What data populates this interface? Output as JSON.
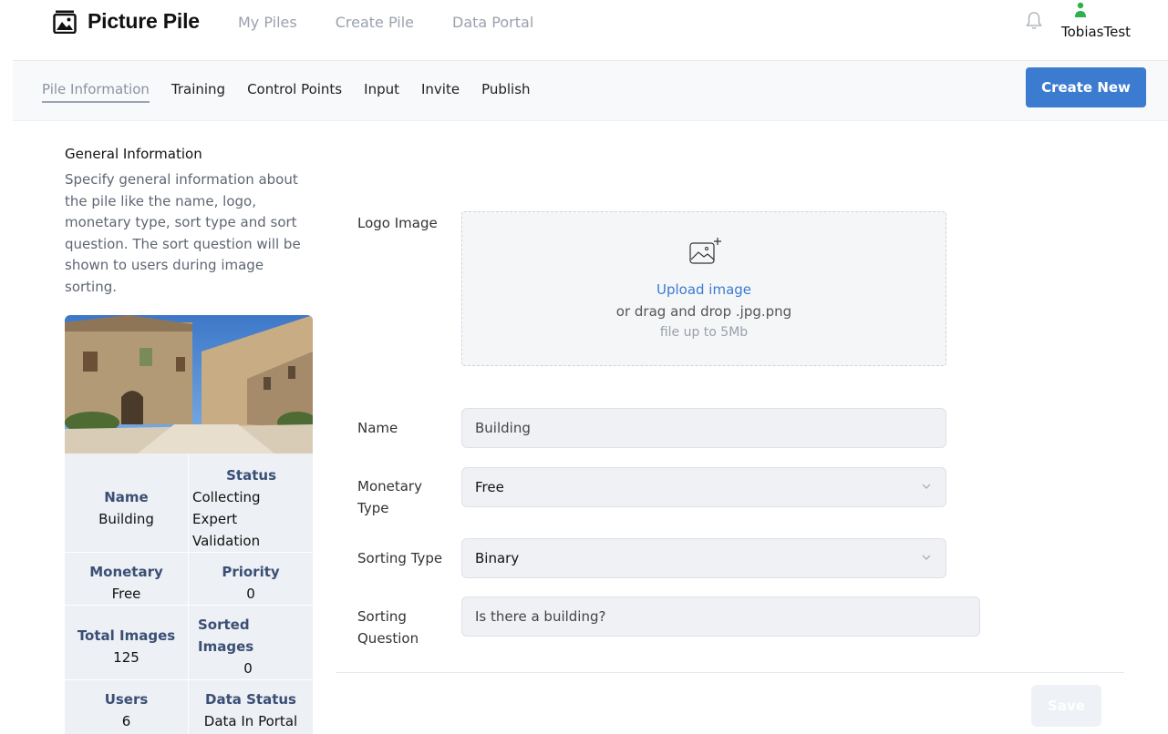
{
  "brand": {
    "name": "Picture Pile",
    "icon": "picture-icon"
  },
  "top_nav": [
    "My Piles",
    "Create Pile",
    "Data Portal"
  ],
  "user": {
    "name": "TobiasTest",
    "icon": "user-icon"
  },
  "sub_nav": {
    "tabs": [
      "Pile Information",
      "Training",
      "Control Points",
      "Input",
      "Invite",
      "Publish"
    ],
    "active": "Pile Information",
    "create_label": "Create New"
  },
  "general": {
    "title": "General Information",
    "description": "Specify general information about the pile like the name, logo, monetary type, sort type and sort question. The sort question will be shown to users during image sorting."
  },
  "summary": {
    "name_label": "Name",
    "name_value": "Building",
    "status_label": "Status",
    "status_value": "Collecting Expert Validation",
    "monetary_label": "Monetary",
    "monetary_value": "Free",
    "priority_label": "Priority",
    "priority_value": "0",
    "total_label": "Total Images",
    "total_value": "125",
    "sorted_label": "Sorted Images",
    "sorted_value": "0",
    "users_label": "Users",
    "users_value": "6",
    "datastatus_label": "Data Status",
    "datastatus_value": "Data In Portal"
  },
  "form": {
    "logo_label": "Logo Image",
    "upload_label": "Upload image",
    "drag_text": "or drag and drop .jpg.png",
    "limit_text": "file up to 5Mb",
    "name_label": "Name",
    "name_value": "Building",
    "monetary_label": "Monetary Type",
    "monetary_value": "Free",
    "sorting_type_label": "Sorting Type",
    "sorting_type_value": "Binary",
    "question_label": "Sorting Question",
    "question_value": "Is there a building?",
    "save_label": "Save"
  },
  "colors": {
    "accent": "#3b7bd0",
    "label": "#3b4f75",
    "user": "#2bb24c"
  }
}
